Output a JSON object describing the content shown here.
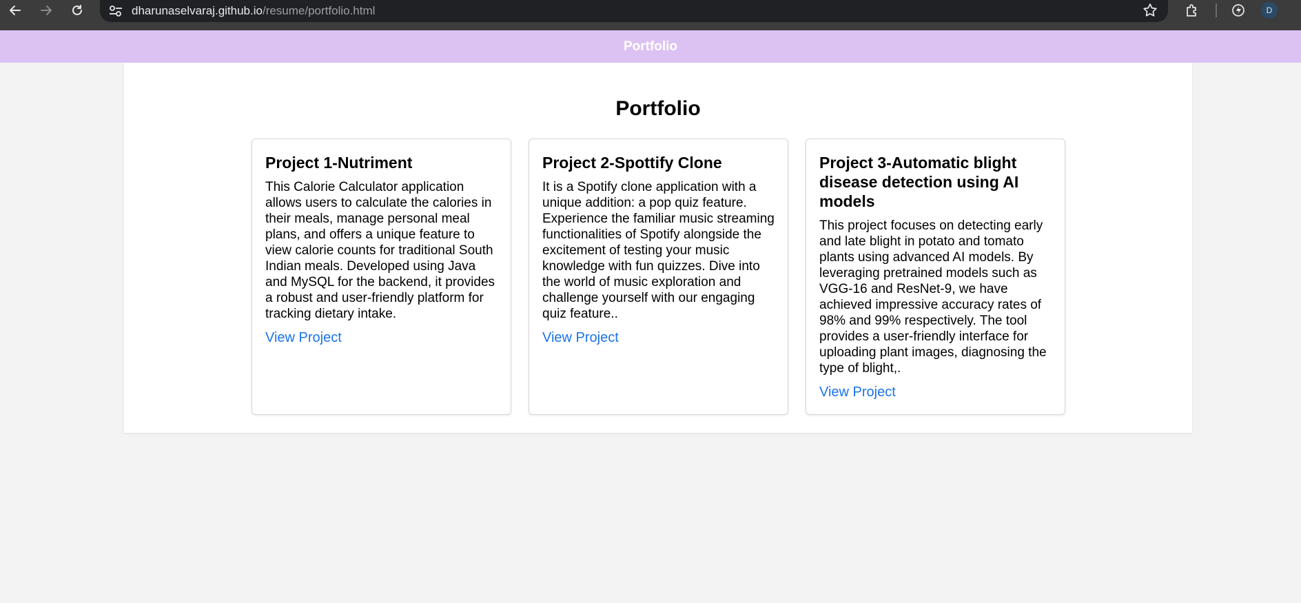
{
  "browser": {
    "url_host": "dharunaselvaraj.github.io",
    "url_path": "/resume/portfolio.html",
    "profile_initial": "D",
    "icons": {
      "back": "back-arrow-icon",
      "forward": "forward-arrow-icon",
      "reload": "reload-icon",
      "site_info": "tune-icon",
      "bookmark": "star-icon",
      "extensions": "puzzle-icon",
      "performance": "performance-icon"
    }
  },
  "header": {
    "title": "Portfolio",
    "background": "#dcc2f2"
  },
  "main": {
    "title": "Portfolio",
    "projects": [
      {
        "title": "Project 1-Nutriment",
        "description": "This Calorie Calculator application allows users to calculate the calories in their meals, manage personal meal plans, and offers a unique feature to view calorie counts for traditional South Indian meals. Developed using Java and MySQL for the backend, it provides a robust and user-friendly platform for tracking dietary intake.",
        "link_label": "View Project"
      },
      {
        "title": "Project 2-Spottify Clone",
        "description": "It is a Spotify clone application with a unique addition: a pop quiz feature. Experience the familiar music streaming functionalities of Spotify alongside the excitement of testing your music knowledge with fun quizzes. Dive into the world of music exploration and challenge yourself with our engaging quiz feature..",
        "link_label": "View Project"
      },
      {
        "title": "Project 3-Automatic blight disease detection using AI models",
        "description": "This project focuses on detecting early and late blight in potato and tomato plants using advanced AI models. By leveraging pretrained models such as VGG-16 and ResNet-9, we have achieved impressive accuracy rates of 98% and 99% respectively. The tool provides a user-friendly interface for uploading plant images, diagnosing the type of blight,.",
        "link_label": "View Project"
      }
    ],
    "link_color": "#1a73e8"
  }
}
